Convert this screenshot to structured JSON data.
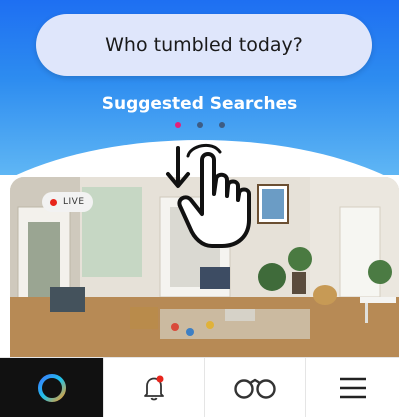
{
  "search": {
    "prompt": "Who tumbled today?"
  },
  "suggestions": {
    "title": "Suggested Searches",
    "page_count": 3,
    "active_page": 1
  },
  "camera": {
    "live_label": "LIVE"
  },
  "nav": {
    "items": [
      {
        "name": "home",
        "icon": "ring-logo-icon"
      },
      {
        "name": "alerts",
        "icon": "bell-icon"
      },
      {
        "name": "watch",
        "icon": "binoculars-icon"
      },
      {
        "name": "menu",
        "icon": "hamburger-menu-icon"
      }
    ]
  },
  "colors": {
    "header_top": "#1e6ff2",
    "header_bottom": "#5fb6f4",
    "active_dot": "#e61f7a",
    "live_dot": "#e8251c",
    "nav_home_bg": "#111111"
  }
}
